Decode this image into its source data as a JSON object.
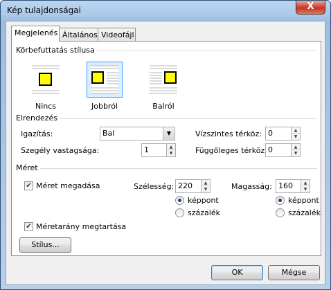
{
  "window": {
    "title": "Kép tulajdonságai",
    "close_glyph": "X"
  },
  "tabs": [
    {
      "label": "Megjelenés",
      "active": true
    },
    {
      "label": "Általános",
      "active": false
    },
    {
      "label": "Videofájl",
      "active": false
    }
  ],
  "wrap_style": {
    "heading": "Körbefuttatás stílusa",
    "options": [
      {
        "label": "Nincs",
        "icon": "wrap-none-icon",
        "selected": false
      },
      {
        "label": "Jobbról",
        "icon": "wrap-right-icon",
        "selected": true
      },
      {
        "label": "Balról",
        "icon": "wrap-left-icon",
        "selected": false
      }
    ]
  },
  "layout": {
    "heading": "Elrendezés",
    "alignment_label": "Igazítás:",
    "alignment_value": "Bal",
    "border_label": "Szegély vastagsága:",
    "border_value": "1",
    "hspace_label": "Vízszintes térköz:",
    "hspace_value": "0",
    "vspace_label": "Függőleges térköz:",
    "vspace_value": "0"
  },
  "size": {
    "heading": "Méret",
    "specify_label": "Méret megadása",
    "specify_checked": true,
    "width_label": "Szélesség:",
    "width_value": "220",
    "height_label": "Magasság:",
    "height_value": "160",
    "unit_pixel": "képpont",
    "unit_percent": "százalék",
    "width_unit": "képpont",
    "height_unit": "képpont",
    "keep_ratio_label": "Méretarány megtartása",
    "keep_ratio_checked": true
  },
  "buttons": {
    "style": "Stílus...",
    "ok": "OK",
    "cancel": "Mégse"
  },
  "colors": {
    "image_square": "#ffff00",
    "selection": "#3399ff"
  }
}
